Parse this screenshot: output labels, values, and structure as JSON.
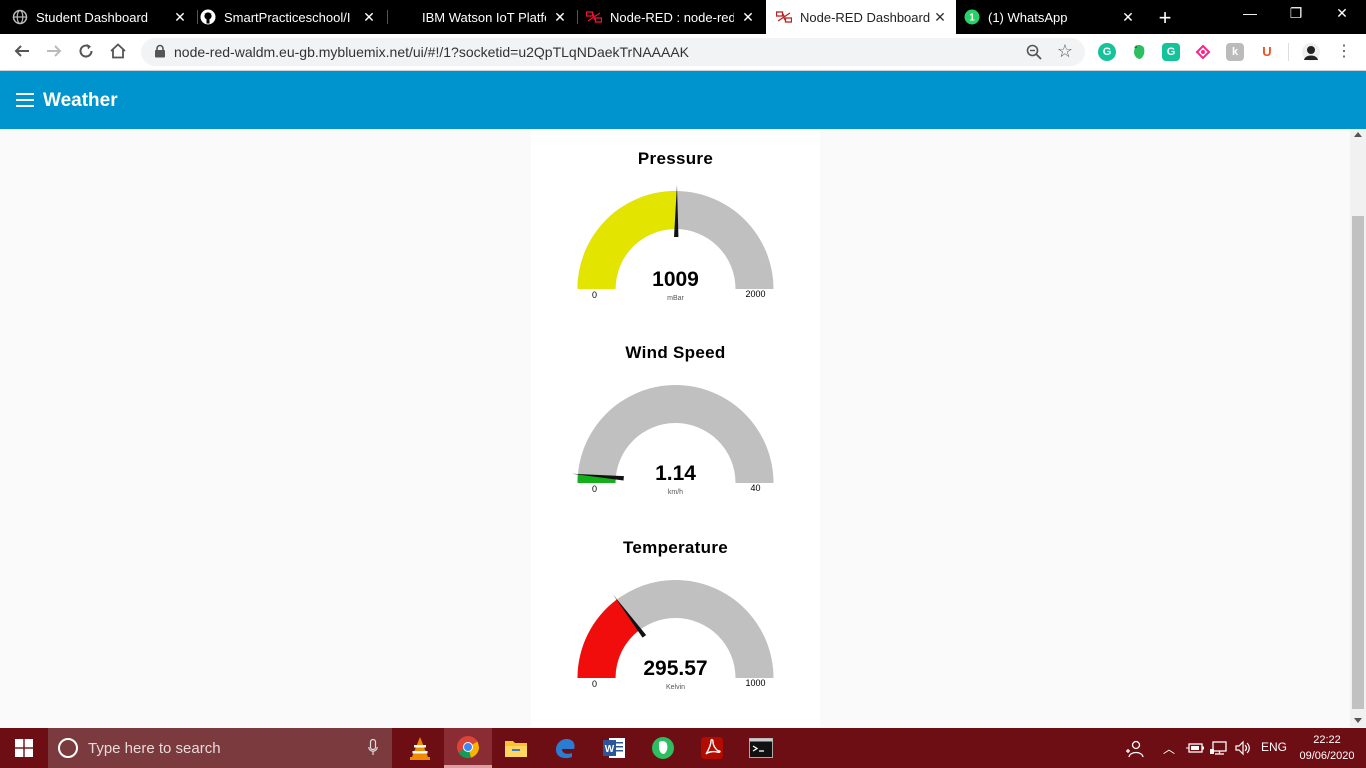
{
  "browser": {
    "tabs": [
      {
        "title": "Student Dashboard",
        "icon": "globe-icon",
        "active": false
      },
      {
        "title": "SmartPracticeschool/IIS",
        "icon": "github-icon",
        "active": false
      },
      {
        "title": "IBM Watson IoT Platfor",
        "icon": "ibm-icon",
        "active": false
      },
      {
        "title": "Node-RED : node-red-w",
        "icon": "node-red-icon",
        "active": false
      },
      {
        "title": "Node-RED Dashboard",
        "icon": "node-red-icon",
        "active": true
      },
      {
        "title": "(1) WhatsApp",
        "icon": "whatsapp-icon",
        "active": false
      }
    ],
    "url": "node-red-waldm.eu-gb.mybluemix.net/ui/#!/1?socketid=u2QpTLqNDaekTrNAAAAK",
    "whatsapp_badge": "1",
    "extensions": [
      "grammarly-icon",
      "evernote-icon",
      "extension-icon",
      "extension-icon",
      "extension-icon",
      "extension-icon"
    ],
    "ext_u_label": "U"
  },
  "app": {
    "title": "Weather"
  },
  "gauges": [
    {
      "title": "Pressure",
      "value": 1009,
      "display": "1009",
      "unit": "mBar",
      "min": 0,
      "max": 2000,
      "min_label": "0",
      "max_label": "2000",
      "color": "#e3e400"
    },
    {
      "title": "Wind Speed",
      "value": 1.14,
      "display": "1.14",
      "unit": "km/h",
      "min": 0,
      "max": 40,
      "min_label": "0",
      "max_label": "40",
      "color": "#14b01c"
    },
    {
      "title": "Temperature",
      "value": 295.57,
      "display": "295.57",
      "unit": "Kelvin",
      "min": 0,
      "max": 1000,
      "min_label": "0",
      "max_label": "1000",
      "color": "#f20d0d"
    }
  ],
  "colors": {
    "header": "#0094ce",
    "gauge_track": "#c0c0c0",
    "taskbar": "#6d0d14"
  },
  "taskbar": {
    "search_placeholder": "Type here to search",
    "language": "ENG",
    "time": "22:22",
    "date": "09/06/2020",
    "apps": [
      "vlc-icon",
      "chrome-icon",
      "file-explorer-icon",
      "edge-icon",
      "word-icon",
      "evernote-icon",
      "acrobat-icon",
      "terminal-icon"
    ]
  }
}
